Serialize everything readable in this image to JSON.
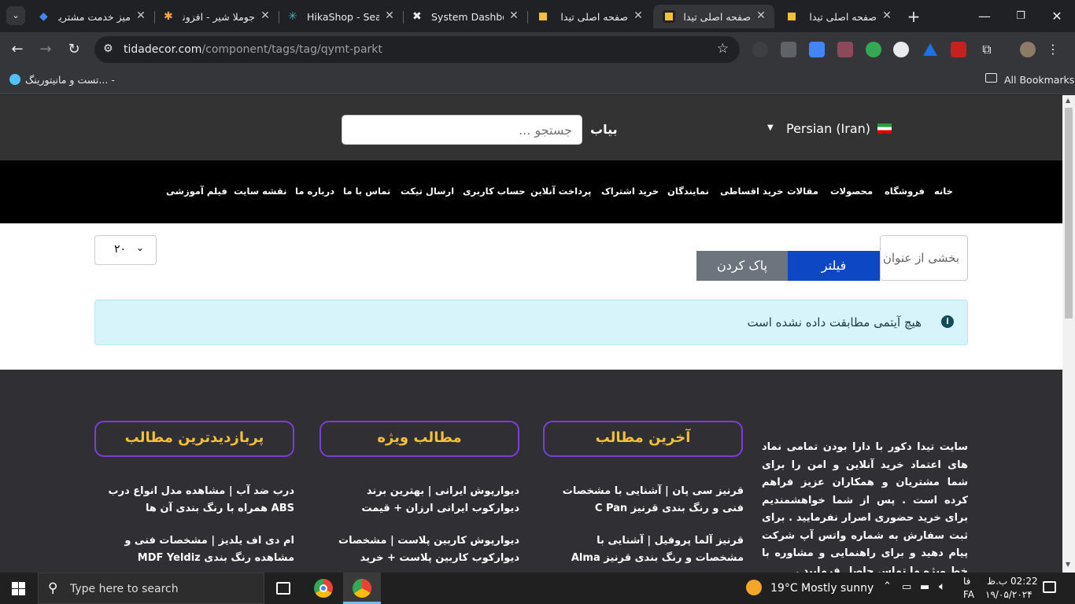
{
  "browser": {
    "tabs": [
      {
        "title": "میز خدمت مشتریان",
        "icon": "diamond-icon",
        "color": "#4285f4"
      },
      {
        "title": "جوملا شیر - افزونه",
        "icon": "joomla-icon",
        "color": "#f9a541"
      },
      {
        "title": "HikaShop - Search",
        "icon": "hikashop-icon",
        "color": "#3bb3c3"
      },
      {
        "title": "System Dashboard",
        "icon": "x-icon",
        "color": "#e8eaed"
      },
      {
        "title": "صفحه اصلی تیدا",
        "icon": "tida-icon",
        "color": "#f2c037"
      },
      {
        "title": "صفحه اصلی تیدا",
        "icon": "tida-icon",
        "color": "#f2c037"
      },
      {
        "title": "صفحه اصلی تیدا",
        "icon": "tida-icon",
        "color": "#f2c037"
      }
    ],
    "url_domain": "tidadecor.com",
    "url_path": "/component/tags/tag/qymt-parkt",
    "bookmark_left": "تست و مانیتورینگ... -",
    "bookmark_right": "All Bookmarks"
  },
  "site": {
    "search_label": "بیاب",
    "search_placeholder": "جستجو ...",
    "language": "Persian (Iran)",
    "menu": [
      "خانه",
      "فروشگاه",
      "محصولات",
      "مقالات",
      "خرید اقساطی",
      "نمایندگان",
      "خرید اشتراک",
      "پرداخت آنلاین",
      "حساب کاربری",
      "ارسال تیکت",
      "تماس با ما",
      "درباره ما",
      "نقشه سایت",
      "فیلم آموزشی"
    ],
    "filter_placeholder": "بخشی از عنوان",
    "filter_button": "فیلتر",
    "clear_button": "پاک کردن",
    "limit_value": "۲۰",
    "no_items": "هیچ آیتمی مطابقت داده نشده است",
    "footer": {
      "about": "سایت تیدا دکور با دارا بودن تمامی نماد های اعتماد خرید آنلاین و امن را برای شما مشتریان و همکاران عزیز فراهم کرده است . پس از شما خواهشمندیم برای خرید حضوری اصرار نفرمایید . برای ثبت سفارش به شماره واتس آپ شرکت پیام دهید و برای راهنمایی و مشاوره با خط ویژه ما تماس حاصل فرمایید .",
      "latest_title": "آخرین مطالب",
      "latest": [
        "قرنیز سی پان | آشنایی با مشخصات فنی و رنگ بندی قرنیز C Pan",
        "قرنیز آلما پروفیل | آشنایی با مشخصات و رنگ بندی قرنیز Alma"
      ],
      "featured_title": "مطالب ویژه",
      "featured": [
        "دیوارپوش ایرانی | بهترین برند دیوارکوب ایرانی ارزان + قیمت",
        "دیوارپوش کاربین پلاست | مشخصات دیوارکوب کاربین پلاست + خرید"
      ],
      "popular_title": "پربازدیدترین مطالب",
      "popular": [
        "درب ضد آب | مشاهده مدل انواع درب ABS همراه با رنگ بندی آن ها",
        "ام دی اف یلدیز | مشخصات فنی و مشاهده رنگ بندی MDF Yeldiz"
      ]
    }
  },
  "taskbar": {
    "search_placeholder": "Type here to search",
    "weather_temp": "19°C",
    "weather_text": "Mostly sunny",
    "lang": "فا",
    "lang2": "FA",
    "time": "02:22 ب.ظ",
    "date": "۱۹/۰۵/۲۰۲۴"
  }
}
